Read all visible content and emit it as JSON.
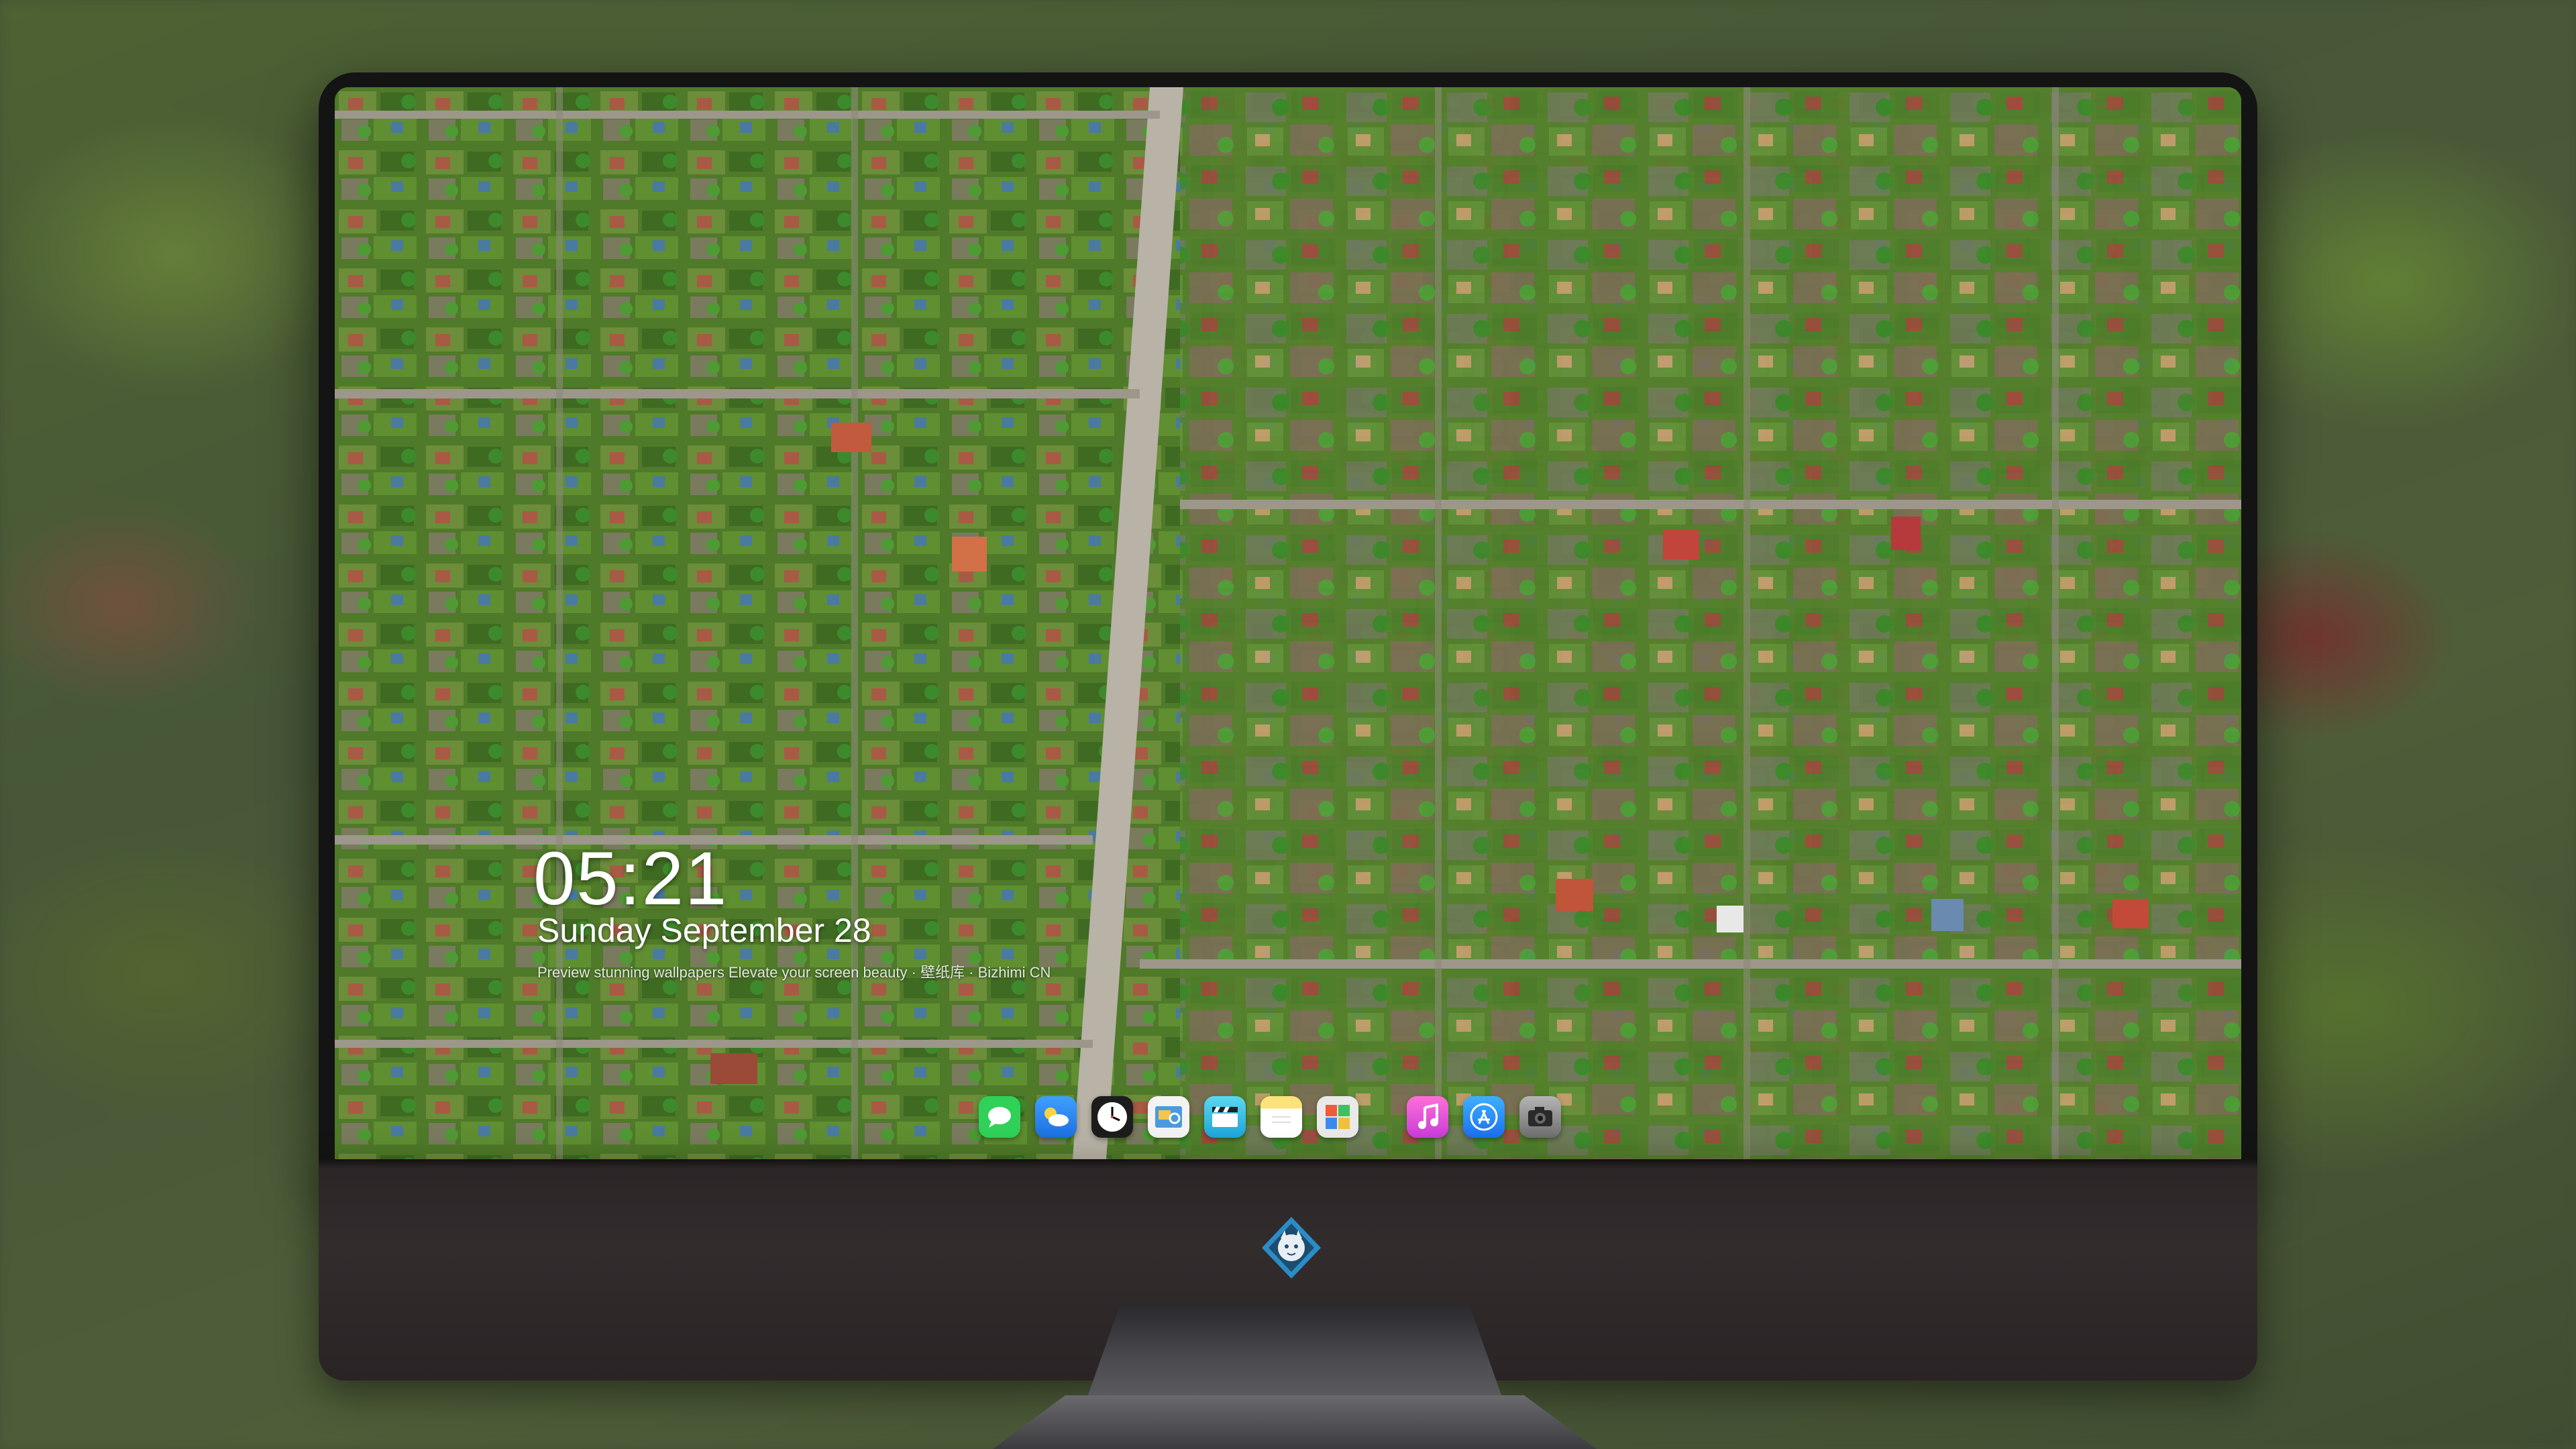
{
  "lockscreen": {
    "time": "05:21",
    "date": "Sunday September 28",
    "caption": "Preview stunning wallpapers Elevate your screen beauty · 壁纸库 · Bizhimi CN"
  },
  "dock": {
    "apps": [
      {
        "name": "messages",
        "icon": "chat-bubble-icon",
        "color": "#2fd158"
      },
      {
        "name": "weather",
        "icon": "cloud-icon",
        "color": "#2b8cf0"
      },
      {
        "name": "clock",
        "icon": "clock-icon",
        "color": "#1c1c1c"
      },
      {
        "name": "preview",
        "icon": "photo-viewer-icon",
        "color": "#f3c64a"
      },
      {
        "name": "clips",
        "icon": "clapperboard-icon",
        "color": "#29c3e6"
      },
      {
        "name": "notes",
        "icon": "note-icon",
        "color": "#f7d54f"
      },
      {
        "name": "photo-booth",
        "icon": "collage-icon",
        "color": "#e9e9e9"
      },
      {
        "name": "music",
        "icon": "music-note-icon",
        "color": "#f04ac2"
      },
      {
        "name": "app-store",
        "icon": "app-store-icon",
        "color": "#1a8cf7"
      },
      {
        "name": "camera",
        "icon": "camera-icon",
        "color": "#8d8d8d"
      }
    ]
  },
  "colors": {
    "bezel": "#141414",
    "chin": "#2f2829",
    "grass": "#5b8a2e"
  }
}
